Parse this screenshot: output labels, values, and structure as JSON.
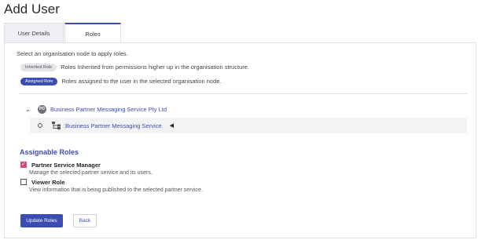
{
  "page": {
    "title": "Add User"
  },
  "tabs": [
    {
      "label": "User Details",
      "active": false
    },
    {
      "label": "Roles",
      "active": true
    }
  ],
  "roles_panel": {
    "instruction": "Select an organisation node to apply roles.",
    "legend": [
      {
        "badge": "Inherited Role",
        "text": "Roles Inherited from permissions higher up in the organisation structure."
      },
      {
        "badge": "Assigned Role",
        "text": "Roles assigned to the user in the selected organisation node."
      }
    ]
  },
  "tree": {
    "root": {
      "badge": "PD",
      "label": "Business Partner Messaging Service Pty Ltd",
      "expanded": true
    },
    "child": {
      "label": "Business Partner Messaging Service",
      "selected": true
    }
  },
  "assignable": {
    "title": "Assignable Roles",
    "roles": [
      {
        "name": "Partner Service Manager",
        "description": "Manage the selected partner service and its users.",
        "checked": true
      },
      {
        "name": "Viewer Role",
        "description": "View information that is being published to the selected partner service.",
        "checked": false
      }
    ]
  },
  "actions": {
    "update_label": "Update Roles",
    "back_label": "Back"
  },
  "colors": {
    "accent": "#3b4db0",
    "checkbox_checked": "#d64a7c",
    "inherited_pill": "#e2e4e7"
  }
}
